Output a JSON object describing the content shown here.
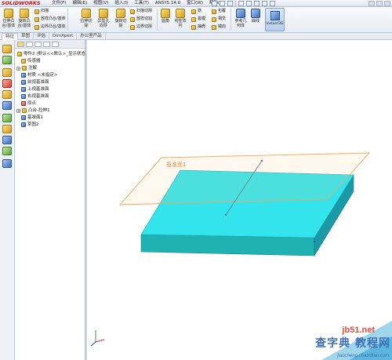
{
  "app": {
    "logo": "SOLIDWORKS"
  },
  "menu": [
    "文件(F)",
    "编辑(E)",
    "视图(V)",
    "插入(I)",
    "工具(T)",
    "ANSYS 14.0",
    "窗口(W)",
    "帮助(H)"
  ],
  "ribbon": {
    "extrude_boss": "拉伸凸\n台/基体",
    "revolve_boss": "旋转凸\n台/基体",
    "sweep": "扫描",
    "loft_boss": "放样凸台/基体",
    "boundary_boss": "边界凸台/基体",
    "extrude_cut": "拉伸切\n除",
    "hole_wizard": "异型孔\n向导",
    "revolve_cut": "旋转切\n除",
    "swept_cut": "扫描切除",
    "lofted_cut": "放样切割",
    "boundary_cut": "边界切除",
    "fillet": "圆角",
    "linear_pattern": "线性阵\n列",
    "rib": "筋",
    "draft": "拔模",
    "shell": "抽壳",
    "wrap": "包覆",
    "intersect": "相交",
    "mirror": "镜向",
    "ref_geometry": "参考几\n何体",
    "curves": "曲线",
    "instant3d": "Instant3D"
  },
  "tabs": [
    "特征",
    "草图",
    "评估",
    "DimXpert",
    "办公室产品"
  ],
  "tree": {
    "root": "零件2 (默认<<默认>_显示状态",
    "items": [
      "传感器",
      "注解",
      "材质 <未指定>",
      "前视基准面",
      "上视基准面",
      "右视基准面",
      "原点",
      "凸台-拉伸1",
      "基准面1",
      "草图2"
    ]
  },
  "viewport": {
    "plane_label": "基准面1"
  },
  "watermark": {
    "site": "jb51.net",
    "name": "查字典 教程网",
    "url": "jiaocheng.chazidian.com"
  }
}
